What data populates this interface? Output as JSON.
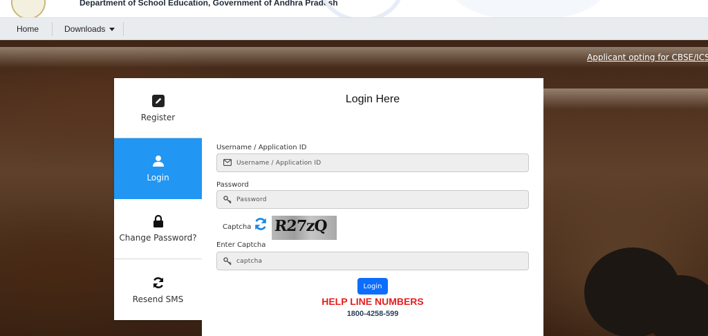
{
  "header": {
    "department": "Department of School Education, Government of Andhra Pradesh"
  },
  "nav": {
    "home": "Home",
    "downloads": "Downloads"
  },
  "marquee": "Applicant opting for CBSE/ICSE/I",
  "side_menu": {
    "register": "Register",
    "login": "Login",
    "change_password": "Change Password?",
    "resend_sms": "Resend SMS"
  },
  "form": {
    "title": "Login Here",
    "username_label": "Username / Application ID",
    "username_placeholder": "Username / Application ID",
    "password_label": "Password",
    "password_placeholder": "Password",
    "captcha_label": "Captcha",
    "captcha_text": "R27zQ",
    "enter_captcha_label": "Enter Captcha",
    "captcha_placeholder": "captcha",
    "login_button": "Login"
  },
  "helpline": {
    "title": "HELP LINE NUMBERS",
    "number": "1800-4258-599"
  },
  "colors": {
    "active_tab": "#2196f3",
    "button": "#0d6efd",
    "helpline": "#e31d1d"
  }
}
